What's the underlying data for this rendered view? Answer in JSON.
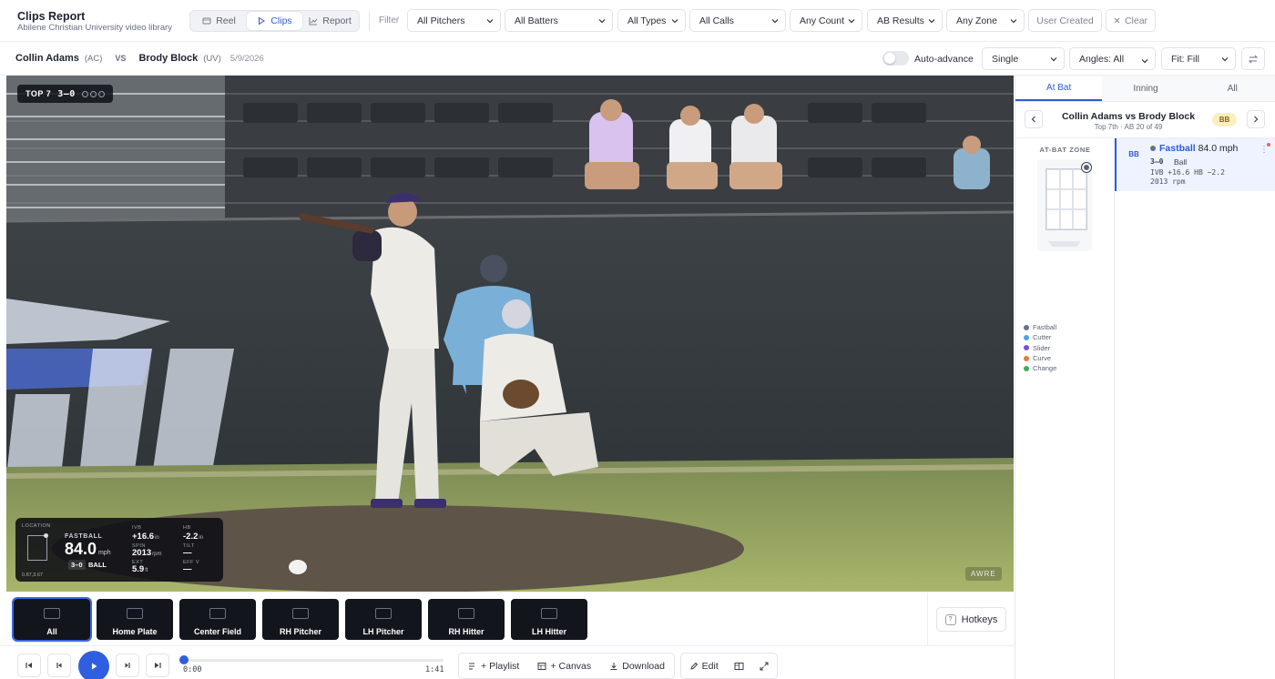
{
  "header": {
    "title": "Clips Report",
    "subtitle": "Abilene Christian University video library",
    "view_tabs": [
      {
        "label": "Reel"
      },
      {
        "label": "Clips"
      },
      {
        "label": "Report"
      }
    ],
    "active_view": "Clips",
    "filter_label": "Filter",
    "filters": [
      {
        "label": "All Pitchers"
      },
      {
        "label": "All Batters"
      },
      {
        "label": "All Types"
      },
      {
        "label": "All Calls"
      },
      {
        "label": "Any Count"
      },
      {
        "label": "AB Results"
      },
      {
        "label": "Any Zone"
      }
    ],
    "user_created": "User Created",
    "clear": "Clear"
  },
  "matchup": {
    "pitcher": "Collin Adams",
    "pitcher_team": "(AC)",
    "vs": "VS",
    "batter": "Brody Block",
    "batter_team": "(UV)",
    "date": "5/9/2026",
    "auto_advance_label": "Auto-advance",
    "auto_advance_on": false,
    "mode": "Single",
    "angles": "Angles: All",
    "fit": "Fit: Fill"
  },
  "video": {
    "scorebug": {
      "inning": "TOP 7",
      "count": "3–0"
    },
    "overlay": {
      "location_label": "LOCATION",
      "location_coord": "0.87,3.67",
      "pitch_type": "FASTBALL",
      "velocity": "84.0",
      "velocity_unit": "mph",
      "count": "3–0",
      "result": "BALL",
      "ivb_label": "IVB",
      "ivb": "+16.6",
      "ivb_unit": "in",
      "hb_label": "HB",
      "hb": "-2.2",
      "hb_unit": "in",
      "spin_label": "SPIN",
      "spin": "2013",
      "spin_unit": "rpm",
      "tilt_label": "TILT",
      "tilt": "—",
      "ext_label": "EXT",
      "ext": "5.9",
      "ext_unit": "ft",
      "effv_label": "EFF V",
      "effv": "—"
    },
    "watermark": "AWRE"
  },
  "angles": [
    {
      "label": "All"
    },
    {
      "label": "Home Plate"
    },
    {
      "label": "Center Field"
    },
    {
      "label": "RH Pitcher"
    },
    {
      "label": "LH Pitcher"
    },
    {
      "label": "RH Hitter"
    },
    {
      "label": "LH Hitter"
    }
  ],
  "active_angle": "All",
  "hotkeys": "Hotkeys",
  "hotkeys_key": "?",
  "player": {
    "current_time": "0:00",
    "total_time": "1:41",
    "progress": 0.0,
    "actions": {
      "playlist": "+ Playlist",
      "canvas": "+ Canvas",
      "download": "Download",
      "edit": "Edit"
    }
  },
  "panel": {
    "tabs": [
      {
        "label": "At Bat"
      },
      {
        "label": "Inning"
      },
      {
        "label": "All"
      }
    ],
    "active_tab": "At Bat",
    "at_bat_title": "Collin Adams vs Brody Block",
    "at_bat_sub": "Top 7th · AB 20 of 49",
    "result_badge": "BB",
    "zone_label": "AT-BAT ZONE",
    "legend": [
      {
        "label": "Fastball",
        "color": "#6b7180"
      },
      {
        "label": "Cutter",
        "color": "#4aa3e8"
      },
      {
        "label": "Slider",
        "color": "#7b4fd6"
      },
      {
        "label": "Curve",
        "color": "#e8793a"
      },
      {
        "label": "Change",
        "color": "#3fae5c"
      }
    ],
    "pitch": {
      "badge": "BB",
      "type": "Fastball",
      "velo": "84.0 mph",
      "count": "3–0",
      "result": "Ball",
      "metrics": "IVB +16.6 HB −2.2",
      "spin": "2013 rpm"
    }
  }
}
